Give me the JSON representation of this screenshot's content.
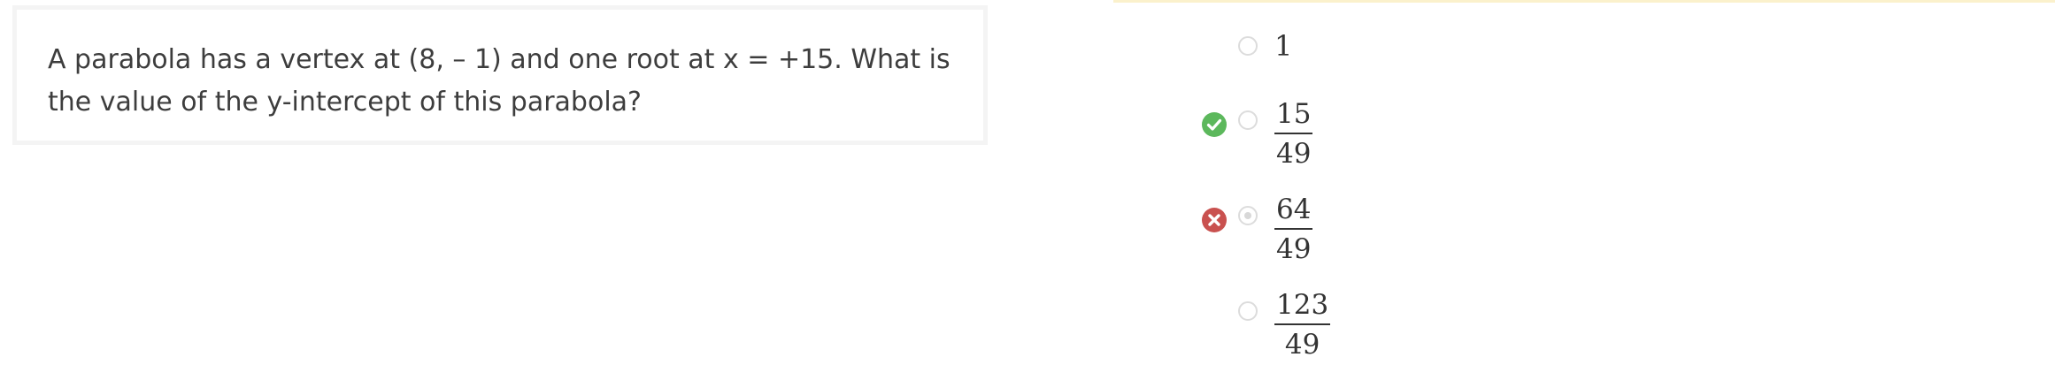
{
  "question": {
    "text": "A parabola has a vertex at (8, – 1) and one root at x = +15.  What is the value of the y-intercept of this parabola?"
  },
  "choices": [
    {
      "label": "1",
      "selected": false,
      "status": "none"
    },
    {
      "numerator": "15",
      "denominator": "49",
      "selected": false,
      "status": "correct",
      "status_icon": "check-circle-icon"
    },
    {
      "numerator": "64",
      "denominator": "49",
      "selected": true,
      "status": "incorrect",
      "status_icon": "x-circle-icon"
    },
    {
      "numerator": "123",
      "denominator": "49",
      "selected": false,
      "status": "none"
    }
  ],
  "colors": {
    "correct": "#5cb85c",
    "incorrect": "#c9514f",
    "accent_line": "#fbf1cc"
  }
}
